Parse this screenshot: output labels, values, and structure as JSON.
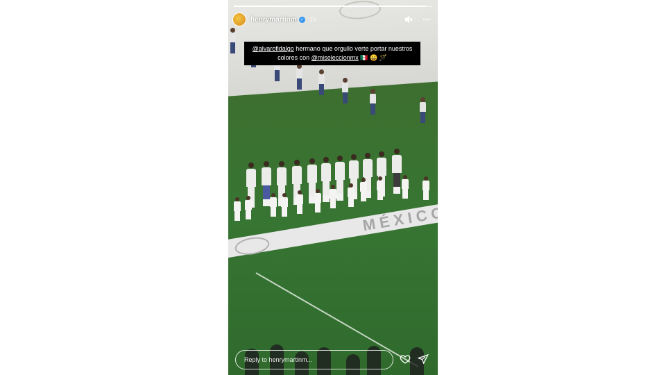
{
  "story": {
    "progress": 0.97,
    "username": "henrymartinm",
    "time": "1h",
    "caption": {
      "mention1": "@alvarofidalgo",
      "text1": " hermano que orgullo verte portar nuestros colores con ",
      "mention2": "@miseleccionmx",
      "emojis": " 🇲🇽 😄 🪄"
    },
    "banner_text": "MÉXICO",
    "reply_placeholder": "Reply to henrymartinm...",
    "icons": {
      "mute": "muted-speaker-icon",
      "more": "more-options-icon",
      "like": "heart-icon",
      "share": "send-icon",
      "verified": "verified-badge-icon"
    }
  }
}
